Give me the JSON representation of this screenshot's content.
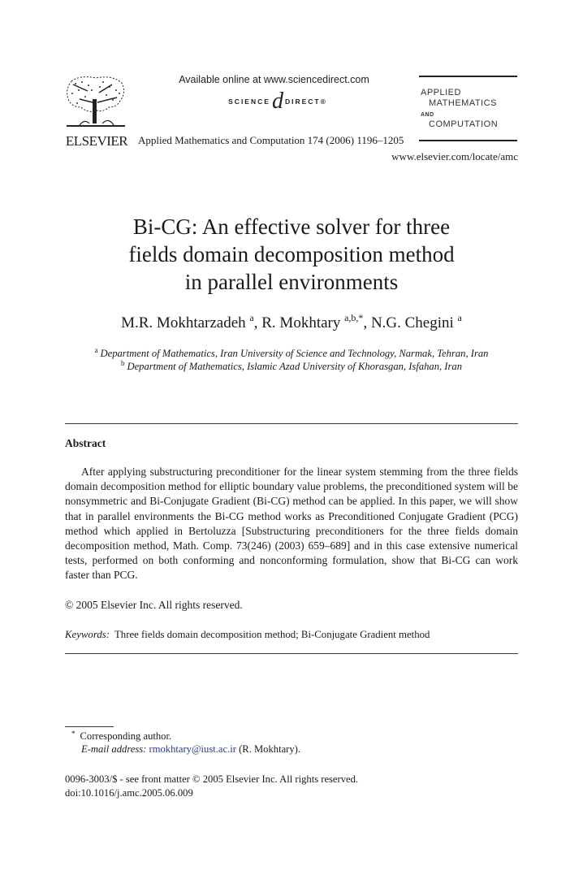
{
  "header": {
    "publisher_logo_text": "ELSEVIER",
    "available_online": "Available online at www.sciencedirect.com",
    "sciencedirect_left": "SCIENCE",
    "sciencedirect_mark": "d",
    "sciencedirect_right": "DIRECT®",
    "journal_citation": "Applied Mathematics and Computation 174 (2006) 1196–1205",
    "journal_logo": [
      "APPLIED",
      "MATHEMATICS",
      "AND",
      "COMPUTATION"
    ],
    "journal_url": "www.elsevier.com/locate/amc"
  },
  "article": {
    "title_lines": [
      "Bi-CG: An effective solver for three",
      "fields domain decomposition method",
      "in parallel environments"
    ],
    "authors": [
      {
        "name": "M.R. Mokhtarzadeh",
        "sup": "a"
      },
      {
        "name": "R. Mokhtary",
        "sup": "a,b,*"
      },
      {
        "name": "N.G. Chegini",
        "sup": "a"
      }
    ],
    "affiliations": [
      {
        "label": "a",
        "text": "Department of Mathematics, Iran University of Science and Technology, Narmak, Tehran, Iran"
      },
      {
        "label": "b",
        "text": "Department of Mathematics, Islamic Azad University of Khorasgan, Isfahan, Iran"
      }
    ]
  },
  "abstract": {
    "heading": "Abstract",
    "body": "After applying substructuring preconditioner for the linear system stemming from the three fields domain decomposition method for elliptic boundary value problems, the preconditioned system will be nonsymmetric and Bi-Conjugate Gradient (Bi-CG) method can be applied. In this paper, we will show that in parallel environments the Bi-CG method works as Preconditioned Conjugate Gradient (PCG) method which applied in Bertoluzza [Substructuring preconditioners for the three fields domain decomposition method, Math. Comp. 73(246) (2003) 659–689] and in this case extensive numerical tests, performed on both conforming and nonconforming formulation, show that Bi-CG can work faster than PCG.",
    "copyright": "© 2005 Elsevier Inc. All rights reserved.",
    "keywords_label": "Keywords:",
    "keywords": "Three fields domain decomposition method; Bi-Conjugate Gradient method"
  },
  "footnotes": {
    "mark": "*",
    "corresponding": "Corresponding author.",
    "email_label": "E-mail address:",
    "email": "rmokhtary@iust.ac.ir",
    "email_owner": "(R. Mokhtary).",
    "front_matter": "0096-3003/$ - see front matter © 2005 Elsevier Inc. All rights reserved.",
    "doi": "doi:10.1016/j.amc.2005.06.009"
  },
  "colors": {
    "link": "#2a3a8c",
    "text": "#1a1a1a"
  }
}
